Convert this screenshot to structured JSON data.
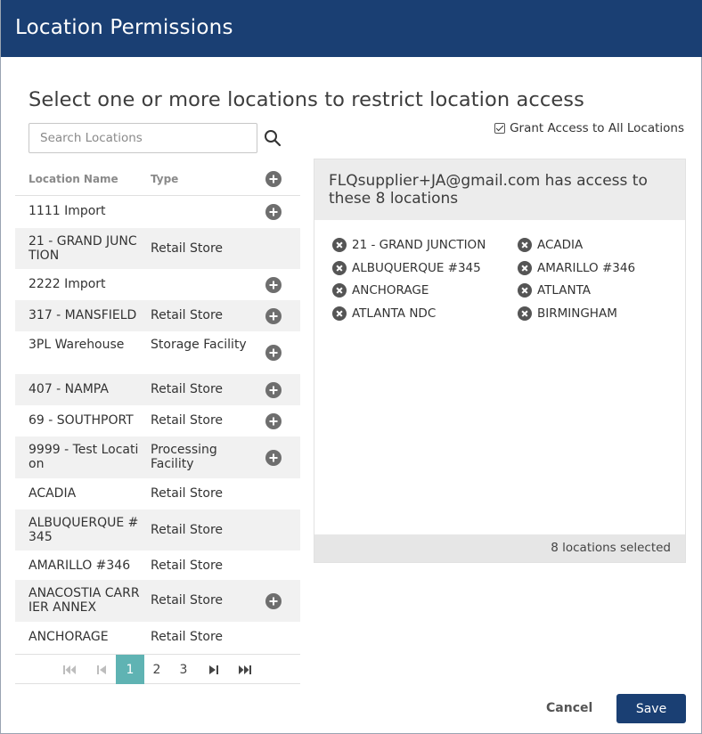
{
  "dialog": {
    "title": "Location Permissions"
  },
  "instruction": "Select one or more locations to restrict location access",
  "search": {
    "placeholder": "Search Locations",
    "value": ""
  },
  "grant_all": {
    "label": "Grant Access to All Locations",
    "checked": true
  },
  "table": {
    "headers": {
      "name": "Location Name",
      "type": "Type"
    },
    "rows": [
      {
        "name": "1111 Import",
        "type": "",
        "addable": true
      },
      {
        "name": "21 - GRAND JUNCTION",
        "type": "Retail Store",
        "addable": false
      },
      {
        "name": "2222 Import",
        "type": "",
        "addable": true
      },
      {
        "name": "317 - MANSFIELD",
        "type": "Retail Store",
        "addable": true
      },
      {
        "name": "3PL Warehouse",
        "type": "Storage Facility",
        "addable": true
      },
      {
        "name": "407 - NAMPA",
        "type": "Retail Store",
        "addable": true
      },
      {
        "name": "69 - SOUTHPORT",
        "type": "Retail Store",
        "addable": true
      },
      {
        "name": "9999 - Test Location",
        "type": "Processing Facility",
        "addable": true
      },
      {
        "name": "ACADIA",
        "type": "Retail Store",
        "addable": false
      },
      {
        "name": "ALBUQUERQUE #345",
        "type": "Retail Store",
        "addable": false
      },
      {
        "name": "AMARILLO #346",
        "type": "Retail Store",
        "addable": false
      },
      {
        "name": "ANACOSTIA CARRIER ANNEX",
        "type": "Retail Store",
        "addable": true
      },
      {
        "name": "ANCHORAGE",
        "type": "Retail Store",
        "addable": false
      }
    ]
  },
  "pagination": {
    "pages": [
      "1",
      "2",
      "3"
    ],
    "current": "1"
  },
  "selected_panel": {
    "title": "FLQsupplier+JA@gmail.com has access to these 8 locations",
    "items": [
      "21 - GRAND JUNCTION",
      "ACADIA",
      "ALBUQUERQUE #345",
      "AMARILLO #346",
      "ANCHORAGE",
      "ATLANTA",
      "ATLANTA NDC",
      "BIRMINGHAM"
    ],
    "footer": "8 locations selected"
  },
  "actions": {
    "cancel": "Cancel",
    "save": "Save"
  },
  "colors": {
    "header": "#1a3f73",
    "active_page": "#5fb3b3",
    "save_button": "#1a3f73"
  },
  "icons": {
    "search": "search-icon",
    "add": "plus-circle-icon",
    "remove": "x-circle-icon",
    "first": "first-page-icon",
    "prev": "prev-page-icon",
    "next": "next-page-icon",
    "last": "last-page-icon"
  }
}
